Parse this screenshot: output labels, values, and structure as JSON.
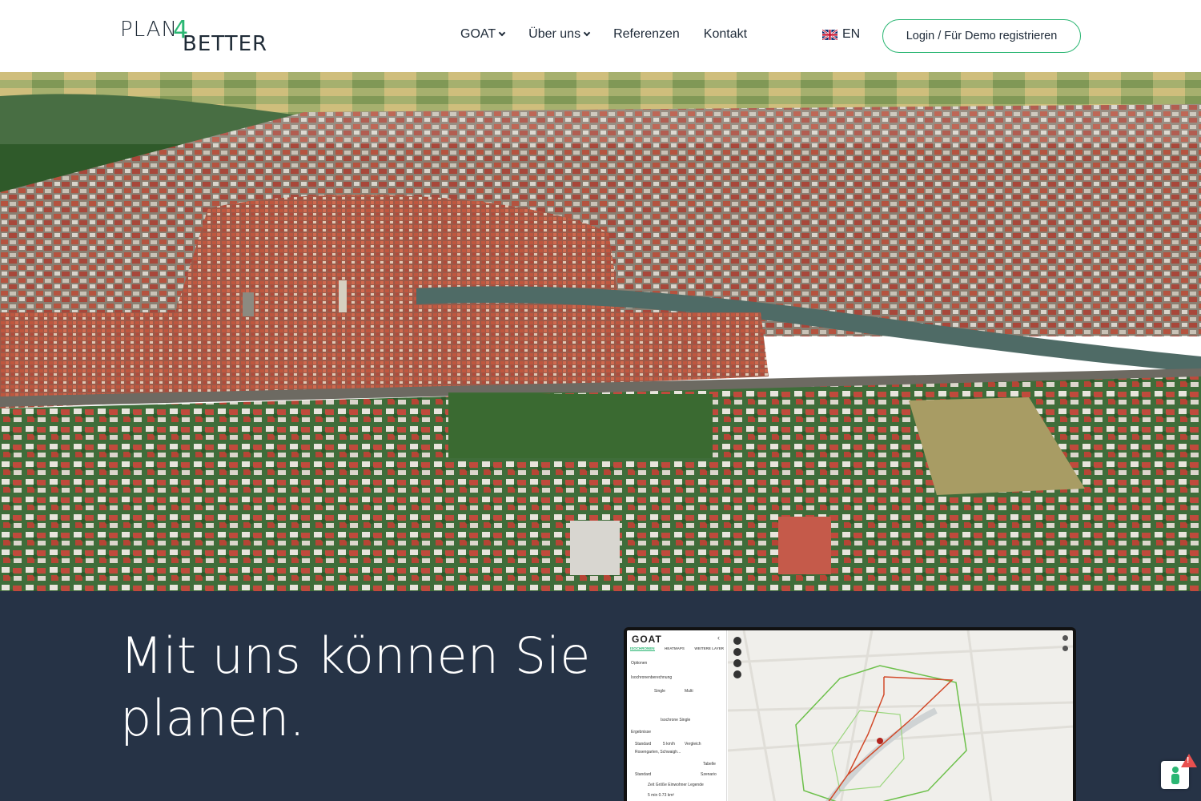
{
  "logo": {
    "line1": "PLAN",
    "digit": "4",
    "line2": "BETTER"
  },
  "nav": {
    "items": [
      {
        "label": "GOAT",
        "dropdown": true
      },
      {
        "label": "Über uns",
        "dropdown": true
      },
      {
        "label": "Referenzen",
        "dropdown": false
      },
      {
        "label": "Kontakt",
        "dropdown": false
      }
    ],
    "language": {
      "flag": "uk-flag-icon",
      "label": "EN"
    },
    "login_label": "Login / Für Demo registrieren"
  },
  "hero": {
    "image": "aerial-city-photo"
  },
  "section": {
    "headline": "Mit uns können Sie planen."
  },
  "app_preview": {
    "logo": "GOAT",
    "tabs": [
      "ISOCHRONEN",
      "HEATMAPS",
      "WEITERE LAYER"
    ],
    "rows": {
      "options": "Optionen",
      "calc": "Isochronenberechnung",
      "single": "Single",
      "multi": "Multi",
      "iso_single": "Isochrone Single",
      "results": "Ergebnisse",
      "standard": "Standard",
      "speed": "5 km/h",
      "compare": "Vergleich",
      "address": "Rosengarten, Schwaigh...",
      "table": "Tabelle",
      "std2": "Standard",
      "scenario": "Szenario",
      "cols": "Zeit    Größe    Einwohner    Legende",
      "r1": "5 min    0.73 km²"
    }
  },
  "colors": {
    "accent": "#2bb673",
    "dark": "#263346"
  }
}
